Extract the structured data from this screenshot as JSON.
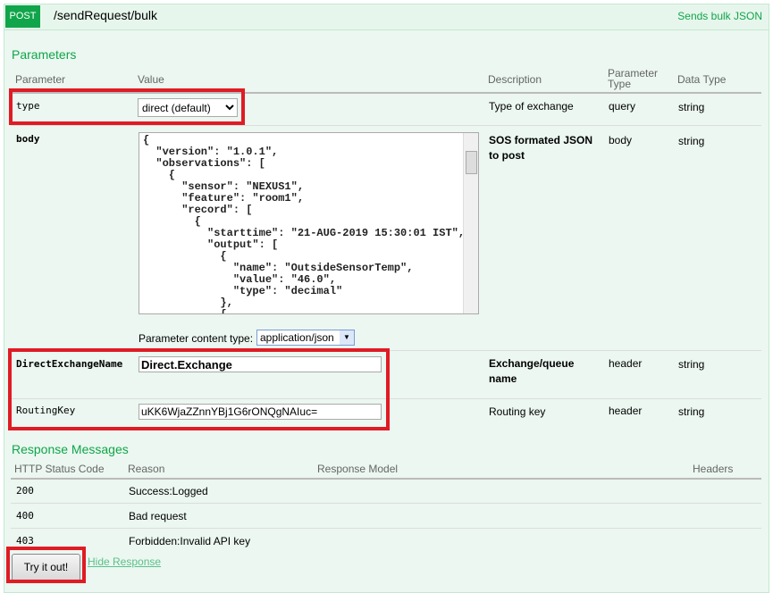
{
  "operation": {
    "method": "POST",
    "path": "/sendRequest/bulk",
    "summary": "Sends bulk JSON"
  },
  "parameters": {
    "title": "Parameters",
    "headers": {
      "parameter": "Parameter",
      "value": "Value",
      "description": "Description",
      "param_type": "Parameter Type",
      "data_type": "Data Type"
    },
    "rows": [
      {
        "name": "type",
        "value": "direct (default)",
        "description": "Type of exchange",
        "param_type": "query",
        "data_type": "string"
      },
      {
        "name": "body",
        "value": "{\n  \"version\": \"1.0.1\",\n  \"observations\": [\n    {\n      \"sensor\": \"NEXUS1\",\n      \"feature\": \"room1\",\n      \"record\": [\n        {\n          \"starttime\": \"21-AUG-2019 15:30:01 IST\",\n          \"output\": [\n            {\n              \"name\": \"OutsideSensorTemp\",\n              \"value\": \"46.0\",\n              \"type\": \"decimal\"\n            },\n            {",
        "description": "SOS formated JSON to post",
        "param_type": "body",
        "data_type": "string",
        "content_type_label": "Parameter content type:",
        "content_type": "application/json"
      },
      {
        "name": "DirectExchangeName",
        "value": "Direct.Exchange",
        "description": "Exchange/queue name",
        "param_type": "header",
        "data_type": "string"
      },
      {
        "name": "RoutingKey",
        "value": "uKK6WjaZZnnYBj1G6rONQgNAIuc=",
        "description": "Routing key",
        "param_type": "header",
        "data_type": "string"
      }
    ]
  },
  "responses": {
    "title": "Response Messages",
    "headers": {
      "code": "HTTP Status Code",
      "reason": "Reason",
      "model": "Response Model",
      "headers": "Headers"
    },
    "rows": [
      {
        "code": "200",
        "reason": "Success:Logged"
      },
      {
        "code": "400",
        "reason": "Bad request"
      },
      {
        "code": "403",
        "reason": "Forbidden:Invalid API key"
      }
    ]
  },
  "actions": {
    "try": "Try it out!",
    "hide": "Hide Response"
  },
  "colors": {
    "accent": "#10a54a",
    "highlight": "#e01b24"
  }
}
